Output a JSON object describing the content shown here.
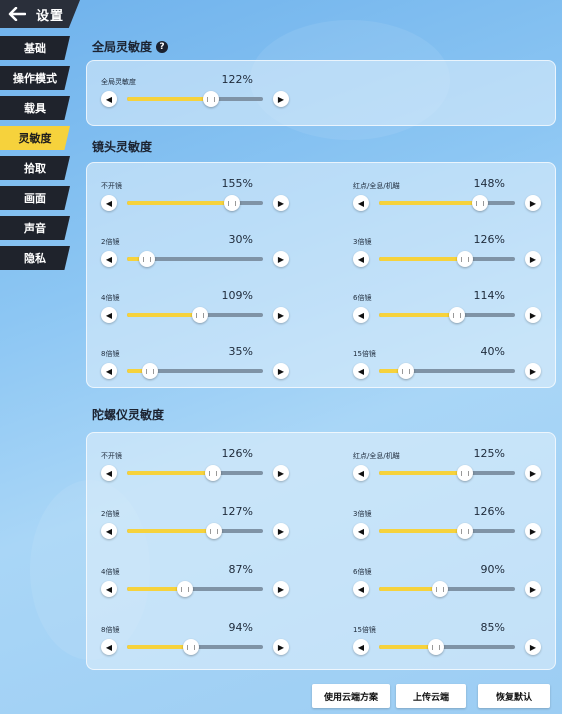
{
  "header": {
    "title": "设置"
  },
  "sidebar": {
    "items": [
      {
        "label": "基础"
      },
      {
        "label": "操作模式"
      },
      {
        "label": "载具"
      },
      {
        "label": "灵敏度"
      },
      {
        "label": "拾取"
      },
      {
        "label": "画面"
      },
      {
        "label": "声音"
      },
      {
        "label": "隐私"
      }
    ],
    "active_index": 3
  },
  "global": {
    "title": "全局灵敏度",
    "help": "?",
    "rows": [
      {
        "label": "全局灵敏度",
        "value": "122%",
        "fraction": 0.62
      }
    ]
  },
  "camera": {
    "title": "镜头灵敏度",
    "rows": [
      {
        "label": "不开镜",
        "value": "155%",
        "fraction": 0.77
      },
      {
        "label": "红点/全息/机瞄",
        "value": "148%",
        "fraction": 0.74
      },
      {
        "label": "2倍镜",
        "value": "30%",
        "fraction": 0.15
      },
      {
        "label": "3倍镜",
        "value": "126%",
        "fraction": 0.63
      },
      {
        "label": "4倍镜",
        "value": "109%",
        "fraction": 0.54
      },
      {
        "label": "6倍镜",
        "value": "114%",
        "fraction": 0.57
      },
      {
        "label": "8倍镜",
        "value": "35%",
        "fraction": 0.17
      },
      {
        "label": "15倍镜",
        "value": "40%",
        "fraction": 0.2
      }
    ]
  },
  "gyro": {
    "title": "陀螺仪灵敏度",
    "rows": [
      {
        "label": "不开镜",
        "value": "126%",
        "fraction": 0.63
      },
      {
        "label": "红点/全息/机瞄",
        "value": "125%",
        "fraction": 0.63
      },
      {
        "label": "2倍镜",
        "value": "127%",
        "fraction": 0.64
      },
      {
        "label": "3倍镜",
        "value": "126%",
        "fraction": 0.63
      },
      {
        "label": "4倍镜",
        "value": "87%",
        "fraction": 0.43
      },
      {
        "label": "6倍镜",
        "value": "90%",
        "fraction": 0.45
      },
      {
        "label": "8倍镜",
        "value": "94%",
        "fraction": 0.47
      },
      {
        "label": "15倍镜",
        "value": "85%",
        "fraction": 0.42
      }
    ]
  },
  "footer": {
    "buttons": [
      {
        "label": "使用云端方案"
      },
      {
        "label": "上传云端"
      },
      {
        "label": "恢复默认"
      }
    ]
  },
  "icons": {
    "back": "back-arrow-icon",
    "decrease": "left-arrow-icon",
    "increase": "right-arrow-icon",
    "help": "help-icon"
  },
  "colors": {
    "accent": "#f6d23c",
    "dark": "#1f232c",
    "track": "#7f93a6"
  }
}
